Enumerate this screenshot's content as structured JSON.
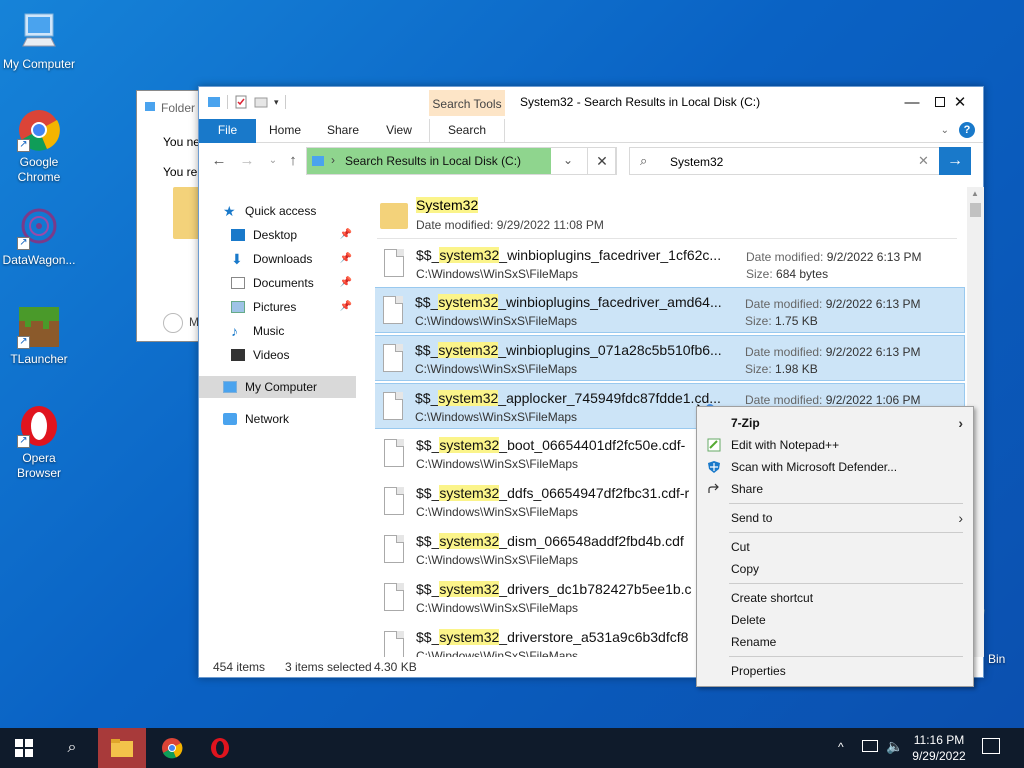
{
  "desktop": {
    "icons": [
      {
        "label": "My Computer"
      },
      {
        "label": "Google Chrome"
      },
      {
        "label": "DataWagon..."
      },
      {
        "label": "TLauncher"
      },
      {
        "label": "Opera Browser"
      }
    ],
    "recycle_label": "Bin"
  },
  "bg_dialog": {
    "title": "Folder",
    "line1": "You ne",
    "line2": "You re",
    "more": "M"
  },
  "explorer": {
    "window_title": "System32 - Search Results in Local Disk (C:)",
    "contextual_tab": "Search Tools",
    "tabs": {
      "file": "File",
      "home": "Home",
      "share": "Share",
      "view": "View",
      "search": "Search"
    },
    "help": "?",
    "address": "Search Results in Local Disk (C:)",
    "search_value": "System32",
    "nav": {
      "quick_access": "Quick access",
      "desktop": "Desktop",
      "downloads": "Downloads",
      "documents": "Documents",
      "pictures": "Pictures",
      "music": "Music",
      "videos": "Videos",
      "my_computer": "My Computer",
      "network": "Network"
    },
    "folder_result": {
      "name": "System32",
      "date_modified": "Date modified: 9/29/2022 11:08 PM"
    },
    "files": [
      {
        "pre": "$$_",
        "hl": "system32",
        "post": "_winbioplugins_facedriver_1cf62c...",
        "path": "C:\\Windows\\WinSxS\\FileMaps",
        "dm_label": "Date modified:",
        "dm": "9/2/2022 6:13 PM",
        "sz_label": "Size:",
        "sz": "684 bytes"
      },
      {
        "pre": "$$_",
        "hl": "system32",
        "post": "_winbioplugins_facedriver_amd64...",
        "path": "C:\\Windows\\WinSxS\\FileMaps",
        "dm_label": "Date modified:",
        "dm": "9/2/2022 6:13 PM",
        "sz_label": "Size:",
        "sz": "1.75 KB"
      },
      {
        "pre": "$$_",
        "hl": "system32",
        "post": "_winbioplugins_071a28c5b510fb6...",
        "path": "C:\\Windows\\WinSxS\\FileMaps",
        "dm_label": "Date modified:",
        "dm": "9/2/2022 6:13 PM",
        "sz_label": "Size:",
        "sz": "1.98 KB"
      },
      {
        "pre": "$$_",
        "hl": "system32",
        "post": "_applocker_745949fdc87fdde1.cd...",
        "path": "C:\\Windows\\WinSxS\\FileMaps",
        "dm_label": "Date modified:",
        "dm": "9/2/2022 1:06 PM",
        "sz_label": "",
        "sz": ""
      },
      {
        "pre": "$$_",
        "hl": "system32",
        "post": "_boot_06654401df2fc50e.cdf-",
        "path": "C:\\Windows\\WinSxS\\FileMaps",
        "dm_label": "",
        "dm": "",
        "sz_label": "",
        "sz": ""
      },
      {
        "pre": "$$_",
        "hl": "system32",
        "post": "_ddfs_06654947df2fbc31.cdf-r",
        "path": "C:\\Windows\\WinSxS\\FileMaps",
        "dm_label": "",
        "dm": "",
        "sz_label": "",
        "sz": ""
      },
      {
        "pre": "$$_",
        "hl": "system32",
        "post": "_dism_066548addf2fbd4b.cdf",
        "path": "C:\\Windows\\WinSxS\\FileMaps",
        "dm_label": "",
        "dm": "",
        "sz_label": "",
        "sz": ""
      },
      {
        "pre": "$$_",
        "hl": "system32",
        "post": "_drivers_dc1b782427b5ee1b.c",
        "path": "C:\\Windows\\WinSxS\\FileMaps",
        "dm_label": "",
        "dm": "",
        "sz_label": "",
        "sz": ""
      },
      {
        "pre": "$$_",
        "hl": "system32",
        "post": "_driverstore_a531a9c6b3dfcf8",
        "path": "C:\\Windows\\WinSxS\\FileMaps",
        "dm_label": "",
        "dm": "",
        "sz_label": "",
        "sz": ""
      }
    ],
    "status": {
      "count": "454 items",
      "selected": "3 items selected",
      "size": "4.30 KB"
    }
  },
  "context_menu": {
    "items": {
      "zip": "7-Zip",
      "notepad": "Edit with Notepad++",
      "defender": "Scan with Microsoft Defender...",
      "share": "Share",
      "send_to": "Send to",
      "cut": "Cut",
      "copy": "Copy",
      "create_shortcut": "Create shortcut",
      "delete": "Delete",
      "rename": "Rename",
      "properties": "Properties"
    }
  },
  "taskbar": {
    "time": "11:16 PM",
    "date": "9/29/2022"
  },
  "colors": {
    "accent": "#1979ca",
    "selection": "#cce4f7",
    "highlight": "#fbf48a",
    "address_fill": "#8fd58e"
  }
}
